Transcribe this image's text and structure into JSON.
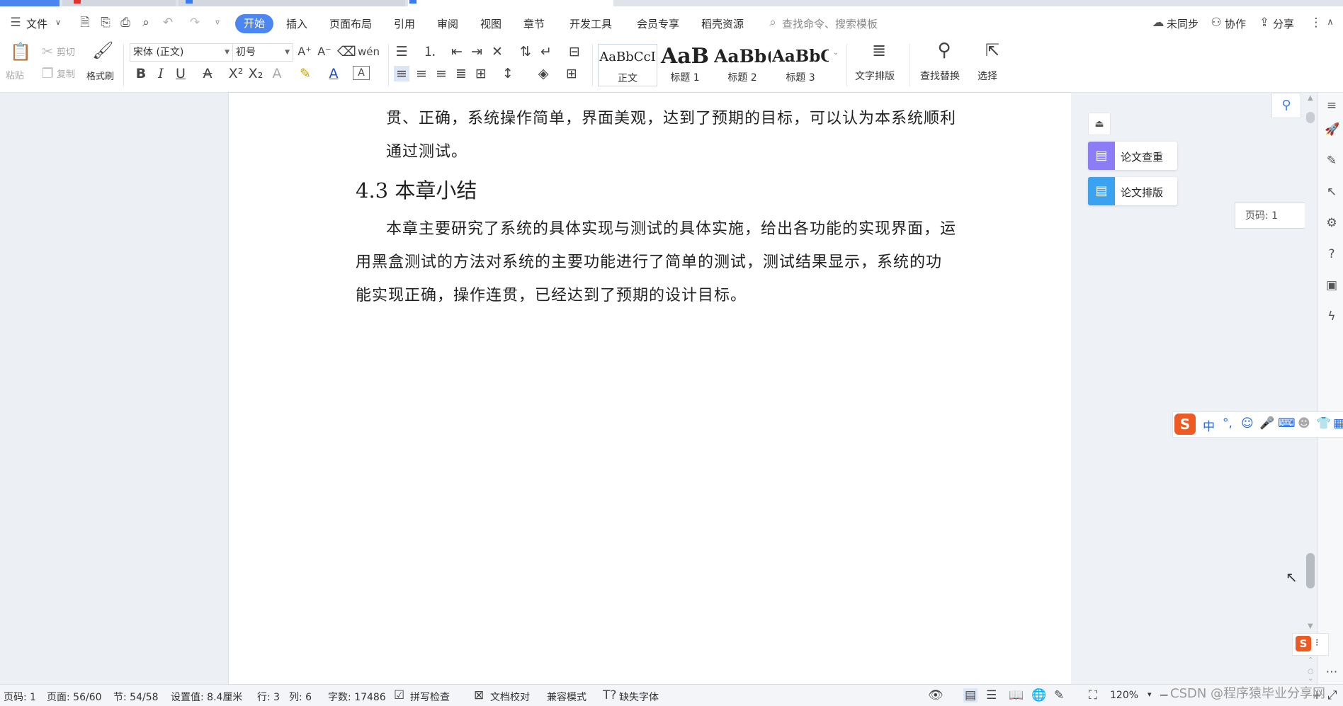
{
  "menu": {
    "file": "文件",
    "tabs": [
      "开始",
      "插入",
      "页面布局",
      "引用",
      "审阅",
      "视图",
      "章节",
      "开发工具",
      "会员专享",
      "稻壳资源"
    ],
    "search_placeholder": "查找命令、搜索模板",
    "sync": "未同步",
    "collab": "协作",
    "share": "分享"
  },
  "ribbon": {
    "paste": "粘贴",
    "cut": "剪切",
    "copy": "复制",
    "format_painter": "格式刷",
    "font_name": "宋体 (正文)",
    "font_size": "初号",
    "styles": [
      {
        "preview": "AaBbCcI",
        "label": "正文"
      },
      {
        "preview": "AaB",
        "label": "标题 1"
      },
      {
        "preview": "AaBb(",
        "label": "标题 2"
      },
      {
        "preview": "AaBbC",
        "label": "标题 3"
      }
    ],
    "text_layout": "文字排版",
    "find_replace": "查找替换",
    "select": "选择"
  },
  "document": {
    "p1_line1": "贯、正确，系统操作简单，界面美观，达到了预期的目标，可以认为本系统顺利",
    "p1_line2": "通过测试。",
    "heading": "4.3 本章小结",
    "p2_line1": "本章主要研究了系统的具体实现与测试的具体实施，给出各功能的实现界面，运",
    "p2_line2": "用黑盒测试的方法对系统的主要功能进行了简单的测试，测试结果显示，系统的功",
    "p2_line3": "能实现正确，操作连贯，已经达到了预期的设计目标。"
  },
  "side_panel": {
    "thesis_check": "论文查重",
    "thesis_format": "论文排版",
    "page_indicator": "页码: 1"
  },
  "ime": {
    "chinese": "中"
  },
  "status": {
    "page_num": "页码: 1",
    "page": "页面: 56/60",
    "section": "节: 54/58",
    "position": "设置值: 8.4厘米",
    "row": "行: 3",
    "col": "列: 6",
    "word_count": "字数: 17486",
    "spell_check": "拼写检查",
    "doc_proof": "文档校对",
    "compat_mode": "兼容模式",
    "missing_font": "缺失字体",
    "zoom": "120%"
  },
  "watermark": "CSDN @程序猿毕业分享网"
}
